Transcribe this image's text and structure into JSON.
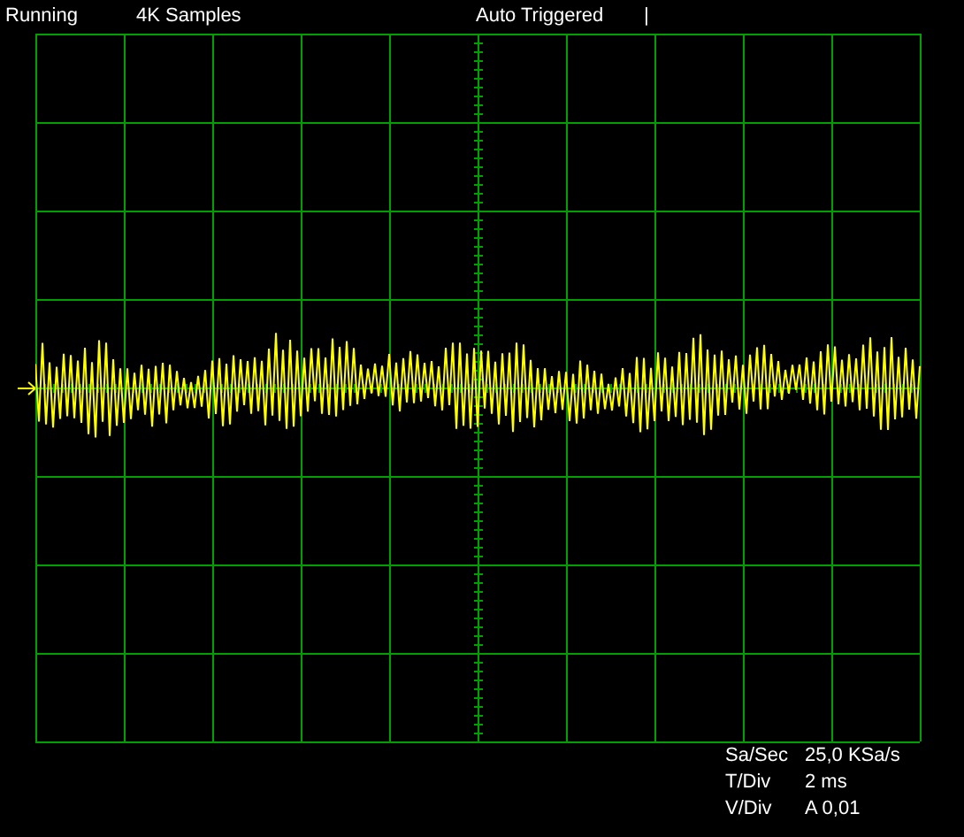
{
  "status_bar": {
    "run_state": "Running",
    "samples": "4K Samples",
    "trigger": "Auto Triggered",
    "cursor": "|"
  },
  "readouts": [
    {
      "label": "Sa/Sec",
      "value": "25,0 KSa/s"
    },
    {
      "label": "T/Div",
      "value": "2 ms"
    },
    {
      "label": "V/Div",
      "value": "A 0,01"
    }
  ]
}
